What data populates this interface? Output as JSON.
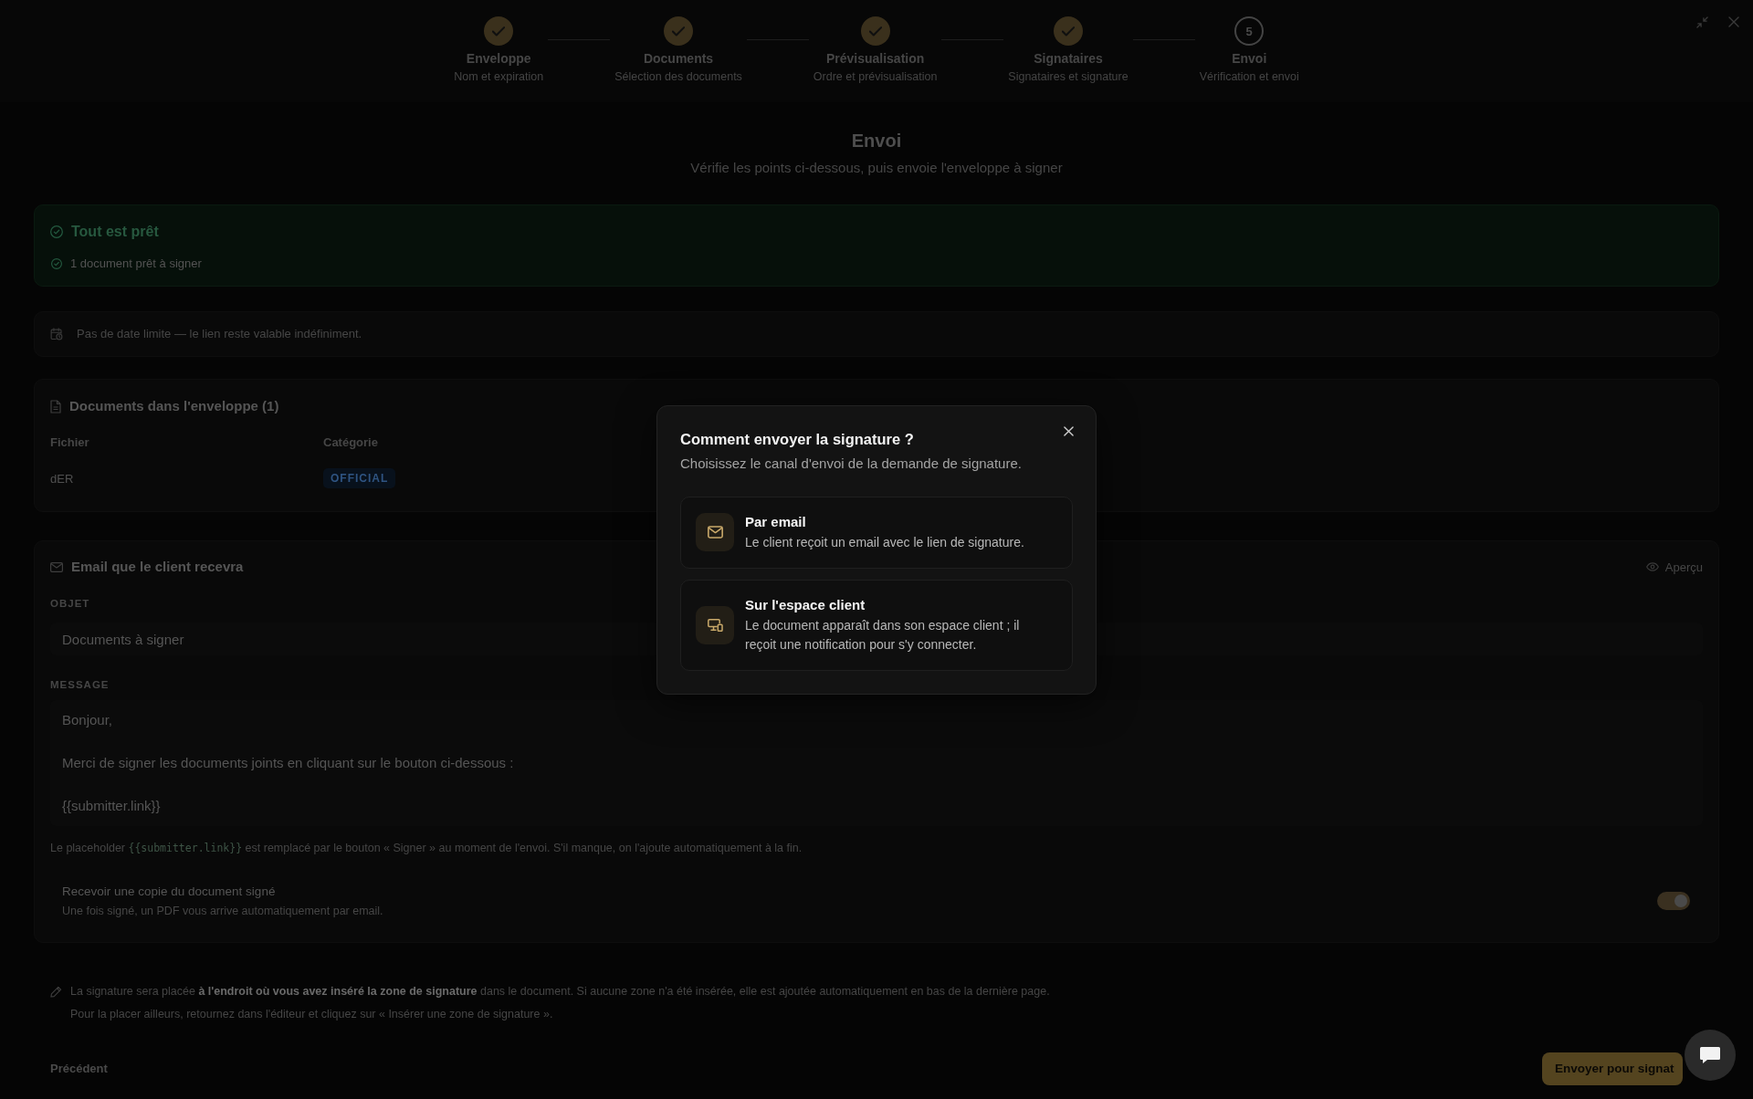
{
  "stepper": {
    "steps": [
      {
        "label": "Enveloppe",
        "sublabel": "Nom et expiration",
        "completed": true
      },
      {
        "label": "Documents",
        "sublabel": "Sélection des documents",
        "completed": true
      },
      {
        "label": "Prévisualisation",
        "sublabel": "Ordre et prévisualisation",
        "completed": true
      },
      {
        "label": "Signataires",
        "sublabel": "Signataires et signature",
        "completed": true
      },
      {
        "label": "Envoi",
        "sublabel": "Vérification et envoi",
        "completed": false,
        "number": "5"
      }
    ]
  },
  "header": {
    "title": "Envoi",
    "subtitle": "Vérifie les points ci-dessous, puis envoie l'enveloppe à signer"
  },
  "readiness": {
    "title": "Tout est prêt",
    "items": [
      "1 document prêt à signer"
    ]
  },
  "expiry": {
    "text": "Pas de date limite — le lien reste valable indéfiniment."
  },
  "documents": {
    "title": "Documents dans l'enveloppe (1)",
    "columns": [
      "Fichier",
      "Catégorie"
    ],
    "rows": [
      {
        "file": "dER",
        "category": "OFFICIAL"
      }
    ]
  },
  "email": {
    "title": "Email que le client recevra",
    "preview_button": "Aperçu",
    "subject": {
      "label": "OBJET",
      "value": "Documents à signer"
    },
    "message": {
      "label": "MESSAGE",
      "lines": [
        "Bonjour,",
        "Merci de signer les documents joints en cliquant sur le bouton ci-dessous :",
        "{{submitter.link}}"
      ]
    },
    "hint": {
      "before": "Le placeholder",
      "code": "{{submitter.link}}",
      "after": "est remplacé par le bouton « Signer » au moment de l'envoi. S'il manque, on l'ajoute automatiquement à la fin."
    },
    "copy_toggle": {
      "label": "Recevoir une copie du document signé",
      "description": "Une fois signé, un PDF vous arrive automatiquement par email.",
      "on": true
    }
  },
  "signature_note": {
    "lines": [
      "La signature sera placée **à l'endroit où vous avez inséré la zone de signature** dans le document. Si aucune zone n'a été insérée, elle est ajoutée automatiquement en bas de la dernière page.",
      "Pour la placer ailleurs, retournez dans l'éditeur et cliquez sur « Insérer une zone de signature »."
    ]
  },
  "footer": {
    "back_button": "Précédent",
    "send_button": "Envoyer pour signat"
  },
  "modal": {
    "title": "Comment envoyer la signature ?",
    "subtitle": "Choisissez le canal d'envoi de la demande de signature.",
    "options": [
      {
        "kind": "email",
        "title": "Par email",
        "description": "Le client reçoit un email avec le lien de signature."
      },
      {
        "kind": "client_space",
        "title": "Sur l'espace client",
        "description": "Le document apparaît dans son espace client ; il reçoit une notification pour s'y connecter."
      }
    ]
  }
}
